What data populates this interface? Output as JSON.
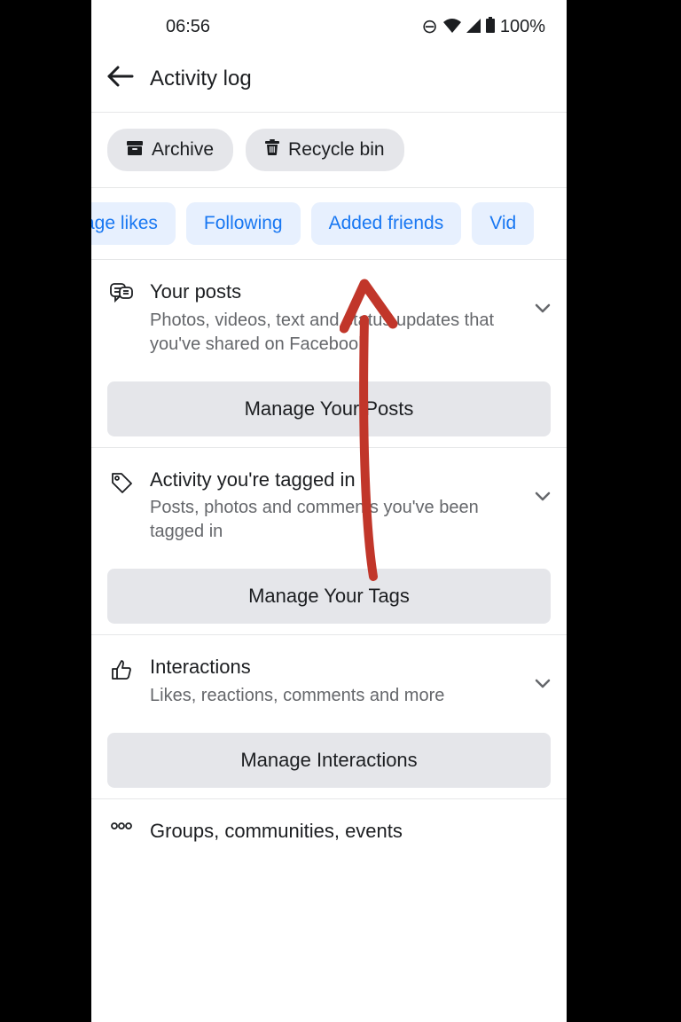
{
  "status": {
    "time": "06:56",
    "battery": "100%"
  },
  "header": {
    "title": "Activity log"
  },
  "chips": {
    "archive": "Archive",
    "recycle": "Recycle bin"
  },
  "filters": {
    "f0": "Page likes",
    "f1": "Following",
    "f2": "Added friends",
    "f3": "Vid"
  },
  "sections": {
    "posts": {
      "title": "Your posts",
      "desc": "Photos, videos, text and status updates that you've shared on Facebook",
      "button": "Manage Your Posts"
    },
    "tagged": {
      "title": "Activity you're tagged in",
      "desc": "Posts, photos and comments you've been tagged in",
      "button": "Manage Your Tags"
    },
    "interactions": {
      "title": "Interactions",
      "desc": "Likes, reactions, comments and more",
      "button": "Manage Interactions"
    },
    "groups": {
      "title": "Groups, communities, events"
    }
  }
}
